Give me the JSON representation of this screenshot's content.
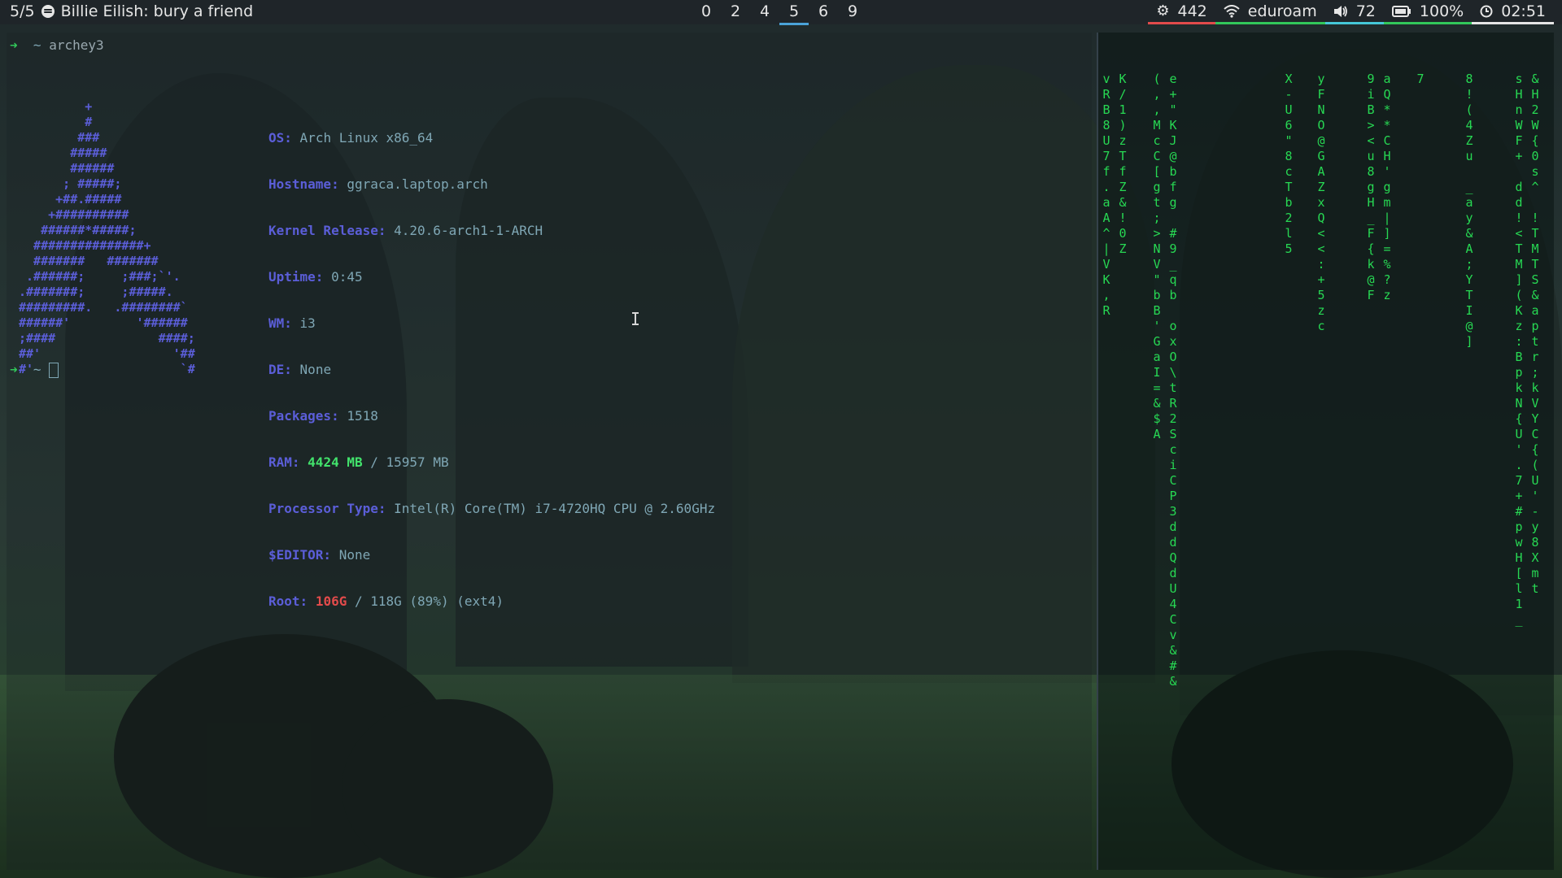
{
  "top_bar": {
    "now_playing": {
      "counter": "5/5",
      "icon": "spotify-icon",
      "title": "Billie Eilish: bury a friend"
    },
    "workspaces": [
      {
        "label": "0",
        "active": false
      },
      {
        "label": "2",
        "active": false
      },
      {
        "label": "4",
        "active": false
      },
      {
        "label": "5",
        "active": true
      },
      {
        "label": "6",
        "active": false
      },
      {
        "label": "9",
        "active": false
      }
    ],
    "status": {
      "memory": {
        "icon": "memory-icon",
        "value": "442",
        "color": "#e24b4b"
      },
      "wifi": {
        "icon": "wifi-icon",
        "value": "eduroam",
        "color": "#32c85a"
      },
      "volume": {
        "icon": "volume-icon",
        "value": "72",
        "color": "#45c8d8"
      },
      "battery": {
        "icon": "battery-icon",
        "value": "100%",
        "color": "#32c85a"
      },
      "clock": {
        "icon": "clock-icon",
        "value": "02:51",
        "color": "#e6e6e6"
      }
    }
  },
  "terminal": {
    "prompt_symbol": "➜",
    "cwd": "~",
    "command": "archey3",
    "ascii_logo": "         +\n         #\n        ###\n       #####\n       ######\n      ; #####;\n     +##.#####\n    +##########\n   ######*#####;\n  ###############+\n  #######   #######\n .######;     ;###;`'.\n.#######;     ;#####.\n#########.   .########`\n######'         '######\n;####              ####;\n##'                  '##\n#'                    `#",
    "info": {
      "os": {
        "label": "OS:",
        "value": "Arch Linux x86_64"
      },
      "hostname": {
        "label": "Hostname:",
        "value": "ggraca.laptop.arch"
      },
      "kernel": {
        "label": "Kernel Release:",
        "value": "4.20.6-arch1-1-ARCH"
      },
      "uptime": {
        "label": "Uptime:",
        "value": "0:45"
      },
      "wm": {
        "label": "WM:",
        "value": "i3"
      },
      "de": {
        "label": "DE:",
        "value": "None"
      },
      "packages": {
        "label": "Packages:",
        "value": "1518"
      },
      "ram": {
        "label": "RAM:",
        "used": "4424 MB",
        "rest": "/ 15957 MB"
      },
      "processor": {
        "label": "Processor Type:",
        "value": "Intel(R) Core(TM) i7-4720HQ CPU @ 2.60GHz"
      },
      "editor": {
        "label": "$EDITOR:",
        "value": "None"
      },
      "root": {
        "label": "Root:",
        "used": "106G",
        "rest": "/ 118G (89%) (ext4)"
      }
    }
  },
  "matrix_columns": [
    "v\nR\nB\n8\nU\n7\nf\n.\na\nA\n^\n|\nV\nK\n,\nR",
    "K\n/\n1\n)\nz\nT\nf\nZ\n&\n!\n0\nZ",
    "(\n,\n,\nM\nc\nC\n[\ng\nt\n;\n>\nN\nV\n\"\nb\nB\n'\nG\na\nI\n=\n&\n$\nA",
    "e\n+\n\"\nK\nJ\n@\nb\nf\ng\n\n#\n9\n_\nq\nb\n\no\nx\nO\n\\\nt\nR\n2\nS\nc\ni\nC\nP\n3\nd\nd\nQ\nd\nU\n4\nC\nv\n&\n#\n&",
    "X\n-\nU\n6\n\"\n8\nc\nT\nb\n2\nl\n5",
    "y\nF\nN\nO\n@\nG\nA\nZ\nx\nQ\n<\n<\n:\n+\n5\nz\nc",
    "9\ni\nB\n>\n<\nu\n8\ng\nH\n_\nF\n{\nk\n@\nF",
    "a\nQ\n*\n*\nC\nH\n'\ng\nm\n|\n]\n=\n%\n?\nz",
    "7",
    "8\n!\n(\n4\nZ\nu\n\n_\na\ny\n&\nA\n;\nY\nT\nI\n@\n]",
    "s\nH\nn\nW\nF\n+\n\nd\nd\n!\n<\nT\nM\n]\n(\nK\nz\n:\nB\np\nk\nN\n{\nU\n'\n.\n7\n+\n#\np\nw\nH\n[\nl\n1\n_",
    "&\nH\n2\nW\n{\n0\ns\n^\n\n!\nT\nM\nT\nS\n&\na\np\nt\nr\n;\nk\nV\nY\nC\n{\n(\nU\n'\n-\ny\n8\nX\nm\nt"
  ]
}
